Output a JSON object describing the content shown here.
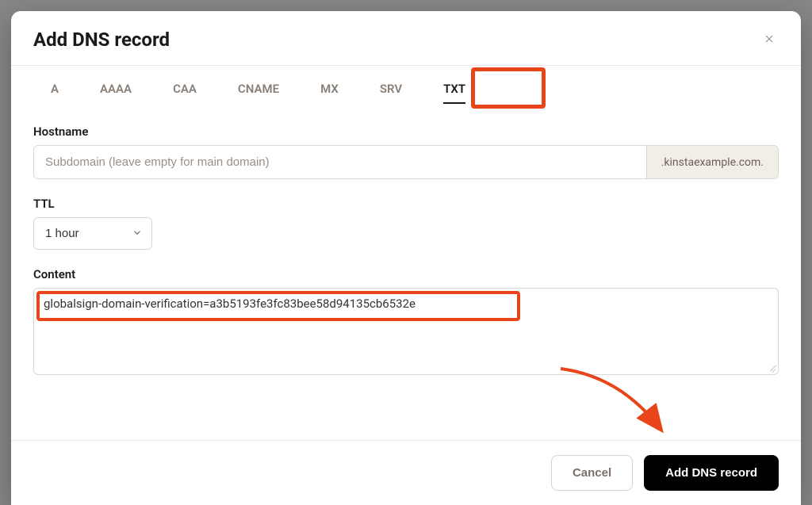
{
  "modal": {
    "title": "Add DNS record"
  },
  "tabs": {
    "items": [
      {
        "label": "A"
      },
      {
        "label": "AAAA"
      },
      {
        "label": "CAA"
      },
      {
        "label": "CNAME"
      },
      {
        "label": "MX"
      },
      {
        "label": "SRV"
      },
      {
        "label": "TXT"
      }
    ],
    "active_index": 6
  },
  "form": {
    "hostname": {
      "label": "Hostname",
      "placeholder": "Subdomain (leave empty for main domain)",
      "value": "",
      "suffix": ".kinstaexample.com."
    },
    "ttl": {
      "label": "TTL",
      "selected": "1 hour"
    },
    "content": {
      "label": "Content",
      "value": "globalsign-domain-verification=a3b5193fe3fc83bee58d94135cb6532e"
    }
  },
  "footer": {
    "cancel": "Cancel",
    "submit": "Add DNS record"
  },
  "annotations": {
    "highlight_tab": "TXT",
    "highlight_content": true,
    "arrow_to_submit": true,
    "highlight_color": "#e8461a"
  }
}
